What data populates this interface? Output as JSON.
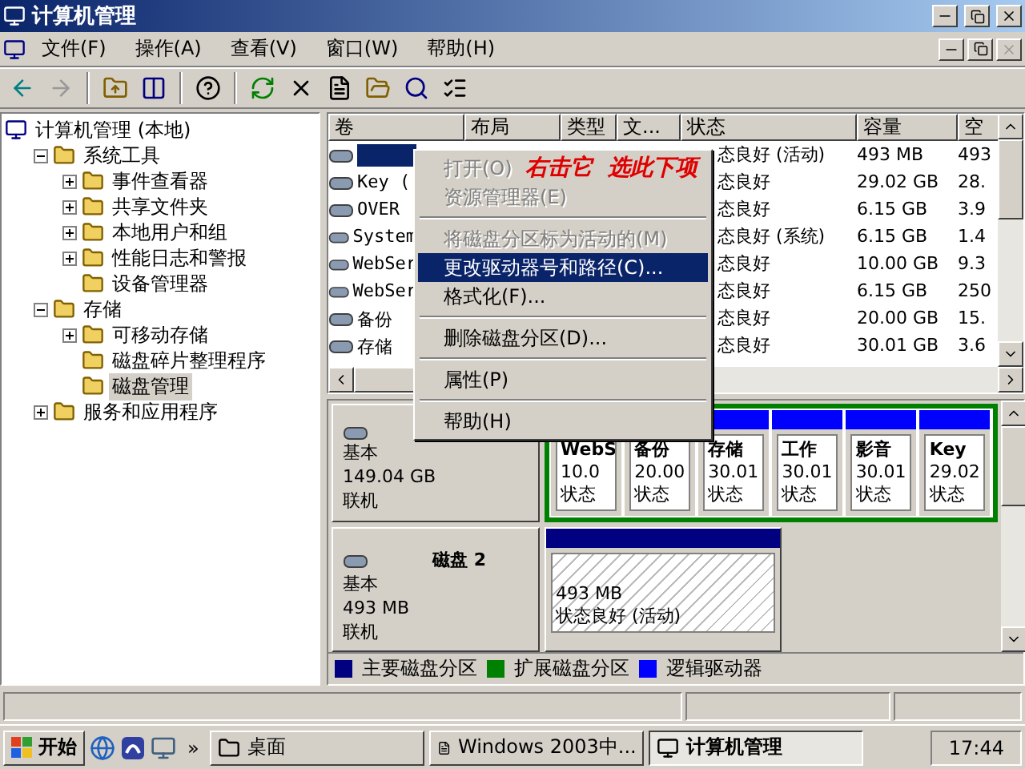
{
  "window": {
    "title": "计算机管理"
  },
  "menu": [
    "文件(F)",
    "操作(A)",
    "查看(V)",
    "窗口(W)",
    "帮助(H)"
  ],
  "tree": {
    "label": "计算机管理 (本地)",
    "selected": false,
    "children": [
      {
        "label": "系统工具",
        "expanded": true,
        "selected": false,
        "children": [
          {
            "label": "事件查看器",
            "expanded": false,
            "selected": false
          },
          {
            "label": "共享文件夹",
            "expanded": false,
            "selected": false
          },
          {
            "label": "本地用户和组",
            "expanded": false,
            "selected": false
          },
          {
            "label": "性能日志和警报",
            "expanded": false,
            "selected": false
          },
          {
            "label": "设备管理器",
            "selected": false
          }
        ]
      },
      {
        "label": "存储",
        "expanded": true,
        "selected": false,
        "children": [
          {
            "label": "可移动存储",
            "expanded": false,
            "selected": false
          },
          {
            "label": "磁盘碎片整理程序",
            "selected": false
          },
          {
            "label": "磁盘管理",
            "selected": true
          }
        ]
      },
      {
        "label": "服务和应用程序",
        "expanded": false,
        "selected": false
      }
    ]
  },
  "table": {
    "columns": [
      "卷",
      "布局",
      "类型",
      "文...",
      "状态",
      "容量",
      "空"
    ],
    "rows": [
      {
        "volume": "",
        "selected": true,
        "status": "态良好 (活动)",
        "capacity": "493 MB",
        "free": "493"
      },
      {
        "volume": "Key (",
        "selected": false,
        "status": "态良好",
        "capacity": "29.02 GB",
        "free": "28."
      },
      {
        "volume": "OVER",
        "selected": false,
        "status": "态良好",
        "capacity": "6.15 GB",
        "free": "3.9"
      },
      {
        "volume": "System",
        "selected": false,
        "status": "态良好 (系统)",
        "capacity": "6.15 GB",
        "free": "1.4"
      },
      {
        "volume": "WebSer",
        "selected": false,
        "status": "态良好",
        "capacity": "10.00 GB",
        "free": "9.3"
      },
      {
        "volume": "WebSer",
        "selected": false,
        "status": "态良好",
        "capacity": "6.15 GB",
        "free": "250"
      },
      {
        "volume": "备份",
        "selected": false,
        "status": "态良好",
        "capacity": "20.00 GB",
        "free": "15."
      },
      {
        "volume": "存储",
        "selected": false,
        "status": "态良好",
        "capacity": "30.01 GB",
        "free": "3.6"
      }
    ]
  },
  "disks": [
    {
      "type": "基本",
      "size": "149.04 GB",
      "state": "联机",
      "partitions": [
        {
          "name": "WebS",
          "size": "10.0",
          "status": "状态"
        },
        {
          "name": "备份",
          "size": "20.00",
          "status": "状态"
        },
        {
          "name": "存储",
          "size": "30.01",
          "status": "状态"
        },
        {
          "name": "工作",
          "size": "30.01",
          "status": "状态"
        },
        {
          "name": "影音",
          "size": "30.01",
          "status": "状态"
        },
        {
          "name": "Key",
          "size": "29.02",
          "status": "状态"
        }
      ]
    },
    {
      "label": "磁盘 2",
      "type": "基本",
      "size": "493 MB",
      "state": "联机",
      "partitions": [
        {
          "size": "493 MB",
          "status": "状态良好 (活动)"
        }
      ]
    }
  ],
  "legend": [
    {
      "label": "主要磁盘分区",
      "color": "#000080"
    },
    {
      "label": "扩展磁盘分区",
      "color": "#008000"
    },
    {
      "label": "逻辑驱动器",
      "color": "#0000ff"
    }
  ],
  "context_menu": [
    {
      "kind": "item",
      "label": "打开(O)",
      "disabled": true,
      "selected": false
    },
    {
      "kind": "item",
      "label": "资源管理器(E)",
      "disabled": true,
      "selected": false
    },
    {
      "kind": "separator"
    },
    {
      "kind": "item",
      "label": "将磁盘分区标为活动的(M)",
      "disabled": true,
      "selected": false
    },
    {
      "kind": "item",
      "label": "更改驱动器号和路径(C)...",
      "disabled": false,
      "selected": true
    },
    {
      "kind": "item",
      "label": "格式化(F)...",
      "disabled": false,
      "selected": false
    },
    {
      "kind": "separator"
    },
    {
      "kind": "item",
      "label": "删除磁盘分区(D)...",
      "disabled": false,
      "selected": false
    },
    {
      "kind": "separator"
    },
    {
      "kind": "item",
      "label": "属性(P)",
      "disabled": false,
      "selected": false
    },
    {
      "kind": "separator"
    },
    {
      "kind": "item",
      "label": "帮助(H)",
      "disabled": false,
      "selected": false
    }
  ],
  "annotation": "右击它  选此下项",
  "taskbar": {
    "start": "开始",
    "more": "»",
    "buttons": [
      {
        "label": "桌面",
        "selected": false
      },
      {
        "label": "Windows 2003中...",
        "selected": false
      },
      {
        "label": "计算机管理",
        "selected": true
      }
    ],
    "clock": "17:44"
  }
}
